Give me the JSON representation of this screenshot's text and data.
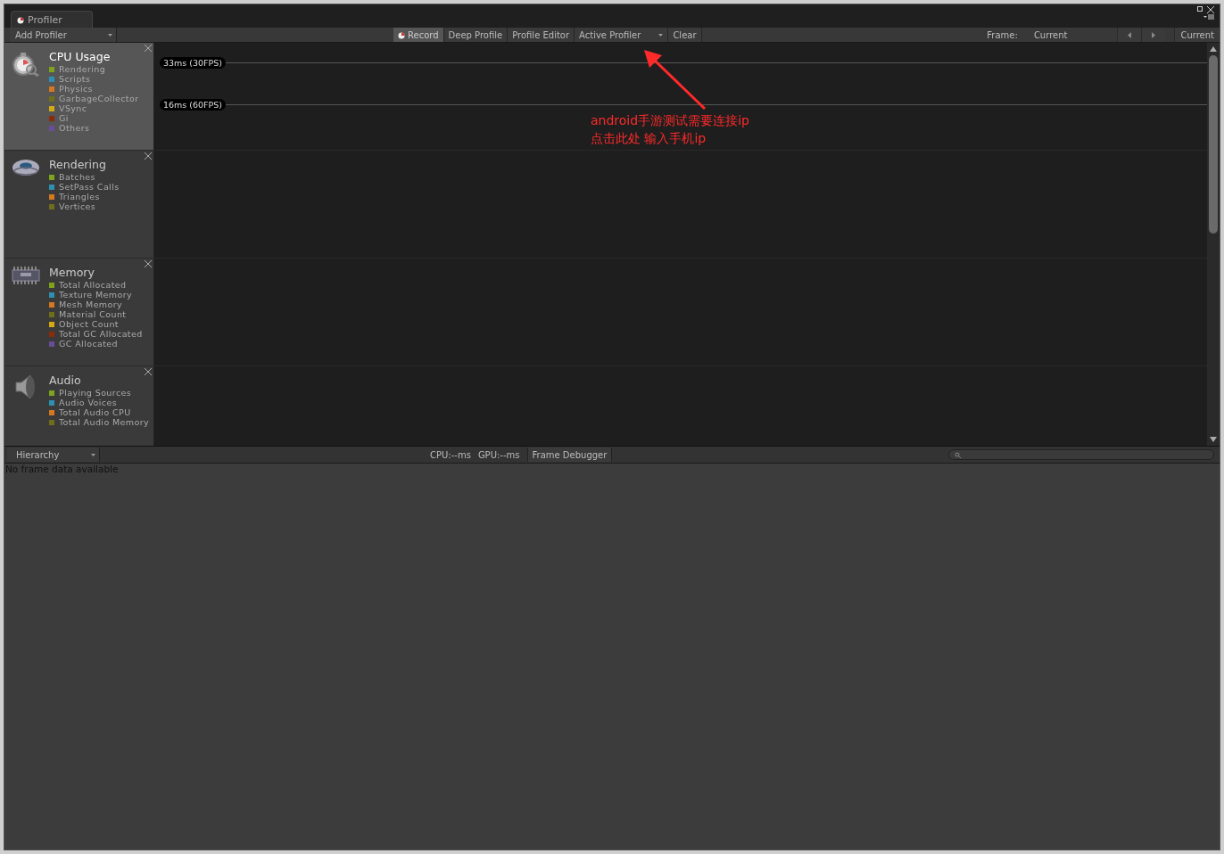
{
  "window": {
    "tab_title": "Profiler"
  },
  "toolbar": {
    "add_profiler": "Add Profiler",
    "buttons": [
      {
        "label": "Record",
        "kind": "record",
        "selected": true
      },
      {
        "label": "Deep Profile",
        "kind": "button",
        "selected": false
      },
      {
        "label": "Profile Editor",
        "kind": "button",
        "selected": false
      },
      {
        "label": "Active Profiler",
        "kind": "dropdown",
        "selected": false
      },
      {
        "label": "Clear",
        "kind": "button",
        "selected": false
      }
    ],
    "frame_label": "Frame:",
    "frame_value": "Current",
    "current_button": "Current"
  },
  "modules": [
    {
      "title": "CPU Usage",
      "selected": true,
      "grid_labels": [
        "33ms (30FPS)",
        "16ms (60FPS)"
      ],
      "legend": [
        {
          "label": "Rendering",
          "color": "#7ea41c"
        },
        {
          "label": "Scripts",
          "color": "#2e8fb2"
        },
        {
          "label": "Physics",
          "color": "#d5781e"
        },
        {
          "label": "GarbageCollector",
          "color": "#6f6e1b"
        },
        {
          "label": "VSync",
          "color": "#d2aa12"
        },
        {
          "label": "Gi",
          "color": "#8a2b0b"
        },
        {
          "label": "Others",
          "color": "#6a4d99"
        }
      ]
    },
    {
      "title": "Rendering",
      "selected": false,
      "legend": [
        {
          "label": "Batches",
          "color": "#7ea41c"
        },
        {
          "label": "SetPass Calls",
          "color": "#2e8fb2"
        },
        {
          "label": "Triangles",
          "color": "#d5781e"
        },
        {
          "label": "Vertices",
          "color": "#6f6e1b"
        }
      ]
    },
    {
      "title": "Memory",
      "selected": false,
      "legend": [
        {
          "label": "Total Allocated",
          "color": "#7ea41c"
        },
        {
          "label": "Texture Memory",
          "color": "#2e8fb2"
        },
        {
          "label": "Mesh Memory",
          "color": "#d5781e"
        },
        {
          "label": "Material Count",
          "color": "#6f6e1b"
        },
        {
          "label": "Object Count",
          "color": "#d2aa12"
        },
        {
          "label": "Total GC Allocated",
          "color": "#8a2b0b"
        },
        {
          "label": "GC Allocated",
          "color": "#6a4d99"
        }
      ]
    },
    {
      "title": "Audio",
      "selected": false,
      "legend": [
        {
          "label": "Playing Sources",
          "color": "#7ea41c"
        },
        {
          "label": "Audio Voices",
          "color": "#2e8fb2"
        },
        {
          "label": "Total Audio CPU",
          "color": "#d5781e"
        },
        {
          "label": "Total Audio Memory",
          "color": "#6f6e1b"
        }
      ]
    }
  ],
  "annotation": {
    "lines": [
      "android手游测试需要连接ip",
      "点击此处 输入手机ip"
    ]
  },
  "details_toolbar": {
    "view": "Hierarchy",
    "cpu": "CPU:--ms",
    "gpu": "GPU:--ms",
    "frame_debugger": "Frame Debugger"
  },
  "details": {
    "message": "No frame data available"
  }
}
